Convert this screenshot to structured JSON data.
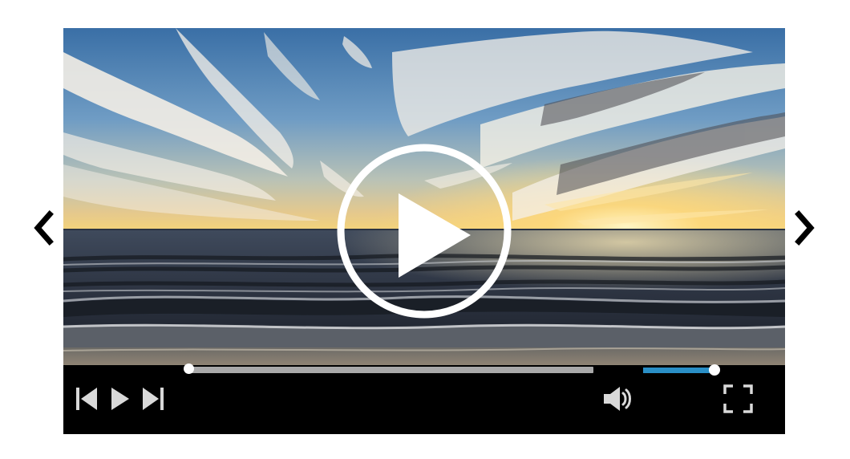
{
  "carousel": {
    "prev_icon": "chevron-left-icon",
    "next_icon": "chevron-right-icon"
  },
  "video": {
    "poster_subject": "sunset-over-ocean",
    "overlay_icon": "play-circle-icon",
    "playing": false
  },
  "controls": {
    "icons": [
      "skip-back-icon",
      "play-icon",
      "skip-forward-icon",
      "volume-icon",
      "fullscreen-icon"
    ],
    "progress": 0.0,
    "volume": 1.0
  },
  "colors": {
    "control_bar": "#000000",
    "progress_track": "#a9a9a9",
    "volume_fill": "#2a8fc6",
    "handle": "#ffffff",
    "icon": "#d9d9d9"
  }
}
